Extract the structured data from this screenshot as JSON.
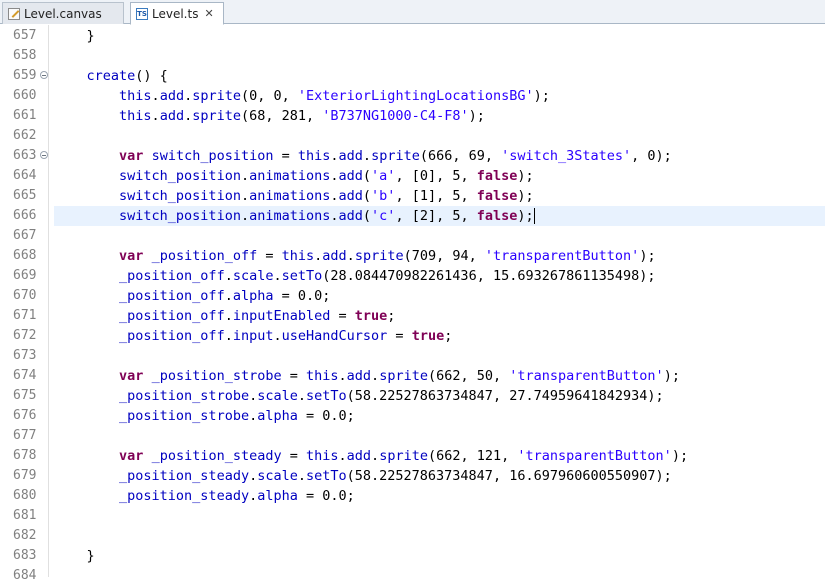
{
  "tabs": [
    {
      "label": "Level.canvas",
      "icon": "pencil-icon",
      "active": false
    },
    {
      "label": "Level.ts",
      "icon": "ts-icon",
      "active": true,
      "close": "✕"
    }
  ],
  "editor": {
    "current_line": 666,
    "lines": [
      {
        "n": "657",
        "segs": [
          [
            "",
            "    }"
          ]
        ]
      },
      {
        "n": "658",
        "segs": []
      },
      {
        "n": "659",
        "fold": true,
        "segs": [
          [
            "",
            "    "
          ],
          [
            "prop",
            "create"
          ],
          [
            "",
            "() {"
          ]
        ]
      },
      {
        "n": "660",
        "segs": [
          [
            "",
            "        "
          ],
          [
            "prop",
            "this"
          ],
          [
            "",
            "."
          ],
          [
            "prop",
            "add"
          ],
          [
            "",
            "."
          ],
          [
            "prop",
            "sprite"
          ],
          [
            "",
            "(0, 0, "
          ],
          [
            "str",
            "'ExteriorLightingLocationsBG'"
          ],
          [
            "",
            ");"
          ]
        ]
      },
      {
        "n": "661",
        "segs": [
          [
            "",
            "        "
          ],
          [
            "prop",
            "this"
          ],
          [
            "",
            "."
          ],
          [
            "prop",
            "add"
          ],
          [
            "",
            "."
          ],
          [
            "prop",
            "sprite"
          ],
          [
            "",
            "(68, 281, "
          ],
          [
            "str",
            "'B737NG1000-C4-F8'"
          ],
          [
            "",
            ");"
          ]
        ]
      },
      {
        "n": "662",
        "segs": []
      },
      {
        "n": "663",
        "fold": true,
        "segs": [
          [
            "",
            "        "
          ],
          [
            "kw",
            "var"
          ],
          [
            "",
            " "
          ],
          [
            "prop",
            "switch_position"
          ],
          [
            "",
            " = "
          ],
          [
            "prop",
            "this"
          ],
          [
            "",
            "."
          ],
          [
            "prop",
            "add"
          ],
          [
            "",
            "."
          ],
          [
            "prop",
            "sprite"
          ],
          [
            "",
            "(666, 69, "
          ],
          [
            "str",
            "'switch_3States'"
          ],
          [
            "",
            ", 0);"
          ]
        ]
      },
      {
        "n": "664",
        "segs": [
          [
            "",
            "        "
          ],
          [
            "prop",
            "switch_position"
          ],
          [
            "",
            "."
          ],
          [
            "prop",
            "animations"
          ],
          [
            "",
            "."
          ],
          [
            "prop",
            "add"
          ],
          [
            "",
            "("
          ],
          [
            "str",
            "'a'"
          ],
          [
            "",
            ", [0], 5, "
          ],
          [
            "kw",
            "false"
          ],
          [
            "",
            ");"
          ]
        ]
      },
      {
        "n": "665",
        "segs": [
          [
            "",
            "        "
          ],
          [
            "prop",
            "switch_position"
          ],
          [
            "",
            "."
          ],
          [
            "prop",
            "animations"
          ],
          [
            "",
            "."
          ],
          [
            "prop",
            "add"
          ],
          [
            "",
            "("
          ],
          [
            "str",
            "'b'"
          ],
          [
            "",
            ", [1], 5, "
          ],
          [
            "kw",
            "false"
          ],
          [
            "",
            ");"
          ]
        ]
      },
      {
        "n": "666",
        "segs": [
          [
            "",
            "        "
          ],
          [
            "prop",
            "switch_position"
          ],
          [
            "",
            "."
          ],
          [
            "prop",
            "animations"
          ],
          [
            "",
            "."
          ],
          [
            "prop",
            "add"
          ],
          [
            "",
            "("
          ],
          [
            "str",
            "'c'"
          ],
          [
            "",
            ", [2], 5, "
          ],
          [
            "kw",
            "false"
          ],
          [
            "",
            ");"
          ]
        ],
        "caret": true
      },
      {
        "n": "667",
        "segs": []
      },
      {
        "n": "668",
        "segs": [
          [
            "",
            "        "
          ],
          [
            "kw",
            "var"
          ],
          [
            "",
            " "
          ],
          [
            "prop",
            "_position_off"
          ],
          [
            "",
            " = "
          ],
          [
            "prop",
            "this"
          ],
          [
            "",
            "."
          ],
          [
            "prop",
            "add"
          ],
          [
            "",
            "."
          ],
          [
            "prop",
            "sprite"
          ],
          [
            "",
            "(709, 94, "
          ],
          [
            "str",
            "'transparentButton'"
          ],
          [
            "",
            ");"
          ]
        ]
      },
      {
        "n": "669",
        "segs": [
          [
            "",
            "        "
          ],
          [
            "prop",
            "_position_off"
          ],
          [
            "",
            "."
          ],
          [
            "prop",
            "scale"
          ],
          [
            "",
            "."
          ],
          [
            "prop",
            "setTo"
          ],
          [
            "",
            "(28.084470982261436, 15.693267861135498);"
          ]
        ]
      },
      {
        "n": "670",
        "segs": [
          [
            "",
            "        "
          ],
          [
            "prop",
            "_position_off"
          ],
          [
            "",
            "."
          ],
          [
            "prop",
            "alpha"
          ],
          [
            "",
            " = 0.0;"
          ]
        ]
      },
      {
        "n": "671",
        "segs": [
          [
            "",
            "        "
          ],
          [
            "prop",
            "_position_off"
          ],
          [
            "",
            "."
          ],
          [
            "prop",
            "inputEnabled"
          ],
          [
            "",
            " = "
          ],
          [
            "kw",
            "true"
          ],
          [
            "",
            ";"
          ]
        ]
      },
      {
        "n": "672",
        "segs": [
          [
            "",
            "        "
          ],
          [
            "prop",
            "_position_off"
          ],
          [
            "",
            "."
          ],
          [
            "prop",
            "input"
          ],
          [
            "",
            "."
          ],
          [
            "prop",
            "useHandCursor"
          ],
          [
            "",
            " = "
          ],
          [
            "kw",
            "true"
          ],
          [
            "",
            ";"
          ]
        ]
      },
      {
        "n": "673",
        "segs": []
      },
      {
        "n": "674",
        "segs": [
          [
            "",
            "        "
          ],
          [
            "kw",
            "var"
          ],
          [
            "",
            " "
          ],
          [
            "prop",
            "_position_strobe"
          ],
          [
            "",
            " = "
          ],
          [
            "prop",
            "this"
          ],
          [
            "",
            "."
          ],
          [
            "prop",
            "add"
          ],
          [
            "",
            "."
          ],
          [
            "prop",
            "sprite"
          ],
          [
            "",
            "(662, 50, "
          ],
          [
            "str",
            "'transparentButton'"
          ],
          [
            "",
            ");"
          ]
        ]
      },
      {
        "n": "675",
        "segs": [
          [
            "",
            "        "
          ],
          [
            "prop",
            "_position_strobe"
          ],
          [
            "",
            "."
          ],
          [
            "prop",
            "scale"
          ],
          [
            "",
            "."
          ],
          [
            "prop",
            "setTo"
          ],
          [
            "",
            "(58.22527863734847, 27.74959641842934);"
          ]
        ]
      },
      {
        "n": "676",
        "segs": [
          [
            "",
            "        "
          ],
          [
            "prop",
            "_position_strobe"
          ],
          [
            "",
            "."
          ],
          [
            "prop",
            "alpha"
          ],
          [
            "",
            " = 0.0;"
          ]
        ]
      },
      {
        "n": "677",
        "segs": []
      },
      {
        "n": "678",
        "segs": [
          [
            "",
            "        "
          ],
          [
            "kw",
            "var"
          ],
          [
            "",
            " "
          ],
          [
            "prop",
            "_position_steady"
          ],
          [
            "",
            " = "
          ],
          [
            "prop",
            "this"
          ],
          [
            "",
            "."
          ],
          [
            "prop",
            "add"
          ],
          [
            "",
            "."
          ],
          [
            "prop",
            "sprite"
          ],
          [
            "",
            "(662, 121, "
          ],
          [
            "str",
            "'transparentButton'"
          ],
          [
            "",
            ");"
          ]
        ]
      },
      {
        "n": "679",
        "segs": [
          [
            "",
            "        "
          ],
          [
            "prop",
            "_position_steady"
          ],
          [
            "",
            "."
          ],
          [
            "prop",
            "scale"
          ],
          [
            "",
            "."
          ],
          [
            "prop",
            "setTo"
          ],
          [
            "",
            "(58.22527863734847, 16.697960600550907);"
          ]
        ]
      },
      {
        "n": "680",
        "segs": [
          [
            "",
            "        "
          ],
          [
            "prop",
            "_position_steady"
          ],
          [
            "",
            "."
          ],
          [
            "prop",
            "alpha"
          ],
          [
            "",
            " = 0.0;"
          ]
        ]
      },
      {
        "n": "681",
        "segs": []
      },
      {
        "n": "682",
        "segs": []
      },
      {
        "n": "683",
        "segs": [
          [
            "",
            "    }"
          ]
        ]
      },
      {
        "n": "684",
        "segs": []
      }
    ]
  }
}
